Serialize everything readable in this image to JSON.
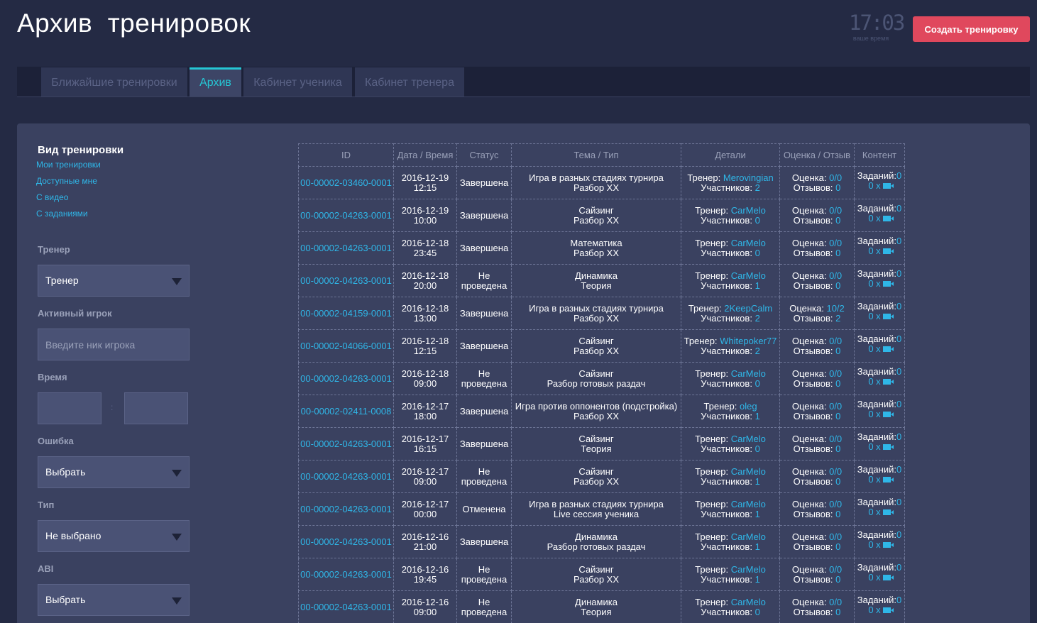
{
  "header": {
    "title": "Архив  тренировок",
    "clock_time": "17:03",
    "clock_label": "ваше время",
    "create_button": "Создать тренировку"
  },
  "tabs": [
    {
      "label": "Ближайшие тренировки",
      "active": false
    },
    {
      "label": "Архив",
      "active": true
    },
    {
      "label": "Кабинет ученика",
      "active": false
    },
    {
      "label": "Кабинет тренера",
      "active": false
    }
  ],
  "sidebar": {
    "title": "Вид тренировки",
    "view_links": [
      "Мои тренировки",
      "Доступные мне",
      "С видео",
      "С заданиями"
    ],
    "trainer": {
      "label": "Тренер",
      "value": "Тренер"
    },
    "player": {
      "label": "Активный игрок",
      "placeholder": "Введите ник игрока"
    },
    "time": {
      "label": "Время",
      "separator": ":"
    },
    "error": {
      "label": "Ошибка",
      "value": "Выбрать"
    },
    "type": {
      "label": "Тип",
      "value": "Не выбрано"
    },
    "abi": {
      "label": "ABI",
      "value": "Выбрать"
    }
  },
  "table": {
    "columns": [
      "ID",
      "Дата / Время",
      "Статус",
      "Тема / Тип",
      "Детали",
      "Оценка / Отзыв",
      "Контент"
    ],
    "labels": {
      "trainer": "Тренер:",
      "participants": "Участников:",
      "rating": "Оценка:",
      "reviews": "Отзывов:",
      "tasks": "Заданий:",
      "video_prefix": "0 x"
    },
    "rows": [
      {
        "id": "00-00002-03460-0001",
        "date": "2016-12-19",
        "time": "12:15",
        "status": [
          "Завершена"
        ],
        "topic": "Игра в разных стадиях турнира",
        "type": "Разбор XX",
        "trainer": "Merovingian",
        "participants": "2",
        "rating": "0/0",
        "reviews": "0",
        "tasks": "0"
      },
      {
        "id": "00-00002-04263-0001",
        "date": "2016-12-19",
        "time": "10:00",
        "status": [
          "Завершена"
        ],
        "topic": "Сайзинг",
        "type": "Разбор XX",
        "trainer": "CarMelo",
        "participants": "0",
        "rating": "0/0",
        "reviews": "0",
        "tasks": "0"
      },
      {
        "id": "00-00002-04263-0001",
        "date": "2016-12-18",
        "time": "23:45",
        "status": [
          "Завершена"
        ],
        "topic": "Математика",
        "type": "Разбор XX",
        "trainer": "CarMelo",
        "participants": "0",
        "rating": "0/0",
        "reviews": "0",
        "tasks": "0"
      },
      {
        "id": "00-00002-04263-0001",
        "date": "2016-12-18",
        "time": "20:00",
        "status": [
          "Не",
          "проведена"
        ],
        "topic": "Динамика",
        "type": "Теория",
        "trainer": "CarMelo",
        "participants": "1",
        "rating": "0/0",
        "reviews": "0",
        "tasks": "0"
      },
      {
        "id": "00-00002-04159-0001",
        "date": "2016-12-18",
        "time": "13:00",
        "status": [
          "Завершена"
        ],
        "topic": "Игра в разных стадиях турнира",
        "type": "Разбор XX",
        "trainer": "2KeepCalm",
        "participants": "2",
        "rating": "10/2",
        "reviews": "2",
        "tasks": "0"
      },
      {
        "id": "00-00002-04066-0001",
        "date": "2016-12-18",
        "time": "12:15",
        "status": [
          "Завершена"
        ],
        "topic": "Сайзинг",
        "type": "Разбор XX",
        "trainer": "Whitepoker77",
        "participants": "2",
        "rating": "0/0",
        "reviews": "0",
        "tasks": "0"
      },
      {
        "id": "00-00002-04263-0001",
        "date": "2016-12-18",
        "time": "09:00",
        "status": [
          "Не",
          "проведена"
        ],
        "topic": "Сайзинг",
        "type": "Разбор готовых раздач",
        "trainer": "CarMelo",
        "participants": "0",
        "rating": "0/0",
        "reviews": "0",
        "tasks": "0"
      },
      {
        "id": "00-00002-02411-0008",
        "date": "2016-12-17",
        "time": "18:00",
        "status": [
          "Завершена"
        ],
        "topic": "Игра против оппонентов (подстройка)",
        "type": "Разбор XX",
        "trainer": "oleg",
        "participants": "1",
        "rating": "0/0",
        "reviews": "0",
        "tasks": "0"
      },
      {
        "id": "00-00002-04263-0001",
        "date": "2016-12-17",
        "time": "16:15",
        "status": [
          "Завершена"
        ],
        "topic": "Сайзинг",
        "type": "Теория",
        "trainer": "CarMelo",
        "participants": "0",
        "rating": "0/0",
        "reviews": "0",
        "tasks": "0"
      },
      {
        "id": "00-00002-04263-0001",
        "date": "2016-12-17",
        "time": "09:00",
        "status": [
          "Не",
          "проведена"
        ],
        "topic": "Сайзинг",
        "type": "Разбор XX",
        "trainer": "CarMelo",
        "participants": "1",
        "rating": "0/0",
        "reviews": "0",
        "tasks": "0"
      },
      {
        "id": "00-00002-04263-0001",
        "date": "2016-12-17",
        "time": "00:00",
        "status": [
          "Отменена"
        ],
        "topic": "Игра в разных стадиях турнира",
        "type": "Live сессия ученика",
        "trainer": "CarMelo",
        "participants": "1",
        "rating": "0/0",
        "reviews": "0",
        "tasks": "0"
      },
      {
        "id": "00-00002-04263-0001",
        "date": "2016-12-16",
        "time": "21:00",
        "status": [
          "Завершена"
        ],
        "topic": "Динамика",
        "type": "Разбор готовых раздач",
        "trainer": "CarMelo",
        "participants": "1",
        "rating": "0/0",
        "reviews": "0",
        "tasks": "0"
      },
      {
        "id": "00-00002-04263-0001",
        "date": "2016-12-16",
        "time": "19:45",
        "status": [
          "Не",
          "проведена"
        ],
        "topic": "Сайзинг",
        "type": "Разбор XX",
        "trainer": "CarMelo",
        "participants": "1",
        "rating": "0/0",
        "reviews": "0",
        "tasks": "0"
      },
      {
        "id": "00-00002-04263-0001",
        "date": "2016-12-16",
        "time": "09:00",
        "status": [
          "Не",
          "проведена"
        ],
        "topic": "Динамика",
        "type": "Теория",
        "trainer": "CarMelo",
        "participants": "0",
        "rating": "0/0",
        "reviews": "0",
        "tasks": "0"
      }
    ]
  },
  "colors": {
    "background": "#242a44",
    "panel": "#3a4160",
    "accent_link": "#2fb7e8",
    "active_tab": "#26c6d4",
    "create_button": "#e0485d"
  }
}
